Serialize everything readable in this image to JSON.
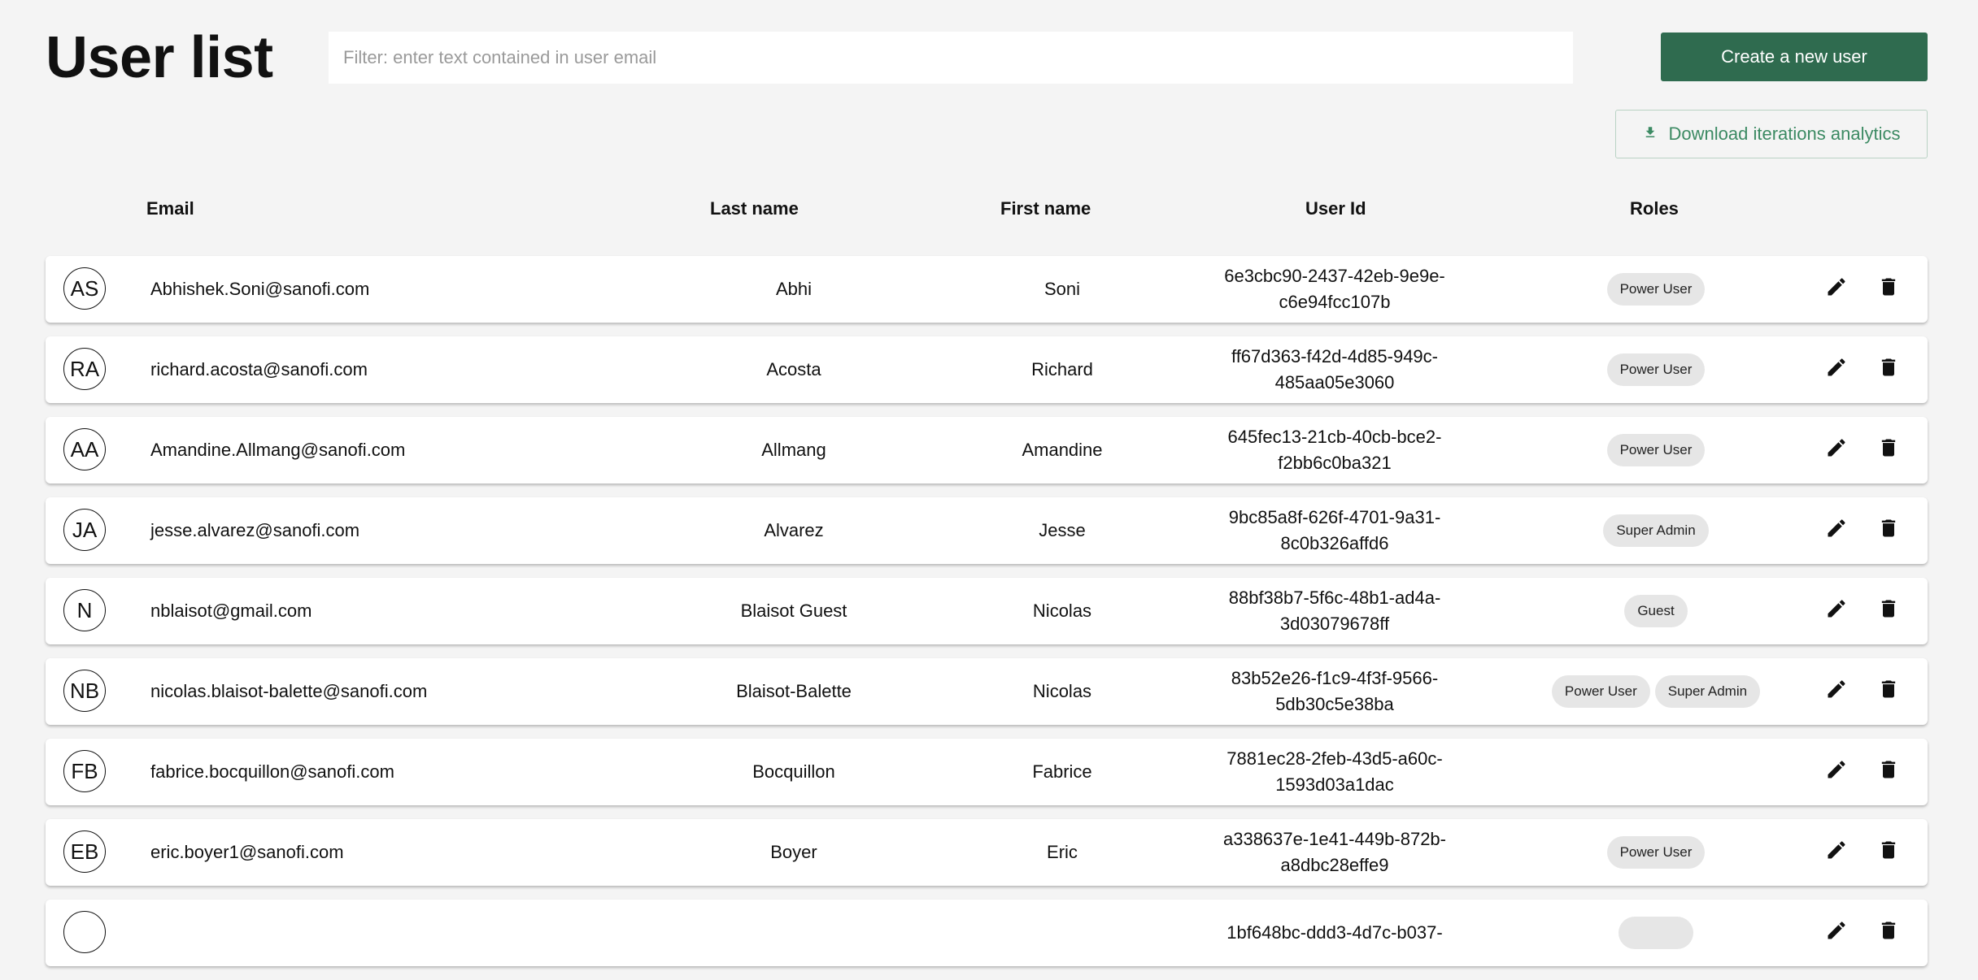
{
  "page": {
    "title": "User list"
  },
  "filter": {
    "placeholder": "Filter: enter text contained in user email",
    "value": ""
  },
  "actions": {
    "create_label": "Create a new user",
    "download_label": "Download iterations analytics",
    "download_icon": "download-icon"
  },
  "table": {
    "columns": {
      "email": "Email",
      "last_name": "Last name",
      "first_name": "First name",
      "user_id": "User Id",
      "roles": "Roles"
    },
    "row_action_icons": [
      "edit-icon",
      "delete-icon"
    ],
    "rows": [
      {
        "initials": "AS",
        "email": "Abhishek.Soni@sanofi.com",
        "last_name": "Abhi",
        "first_name": "Soni",
        "user_id_line1": "6e3cbc90-2437-42eb-9e9e-",
        "user_id_line2": "c6e94fcc107b",
        "roles": [
          "Power User"
        ]
      },
      {
        "initials": "RA",
        "email": "richard.acosta@sanofi.com",
        "last_name": "Acosta",
        "first_name": "Richard",
        "user_id_line1": "ff67d363-f42d-4d85-949c-",
        "user_id_line2": "485aa05e3060",
        "roles": [
          "Power User"
        ]
      },
      {
        "initials": "AA",
        "email": "Amandine.Allmang@sanofi.com",
        "last_name": "Allmang",
        "first_name": "Amandine",
        "user_id_line1": "645fec13-21cb-40cb-bce2-",
        "user_id_line2": "f2bb6c0ba321",
        "roles": [
          "Power User"
        ]
      },
      {
        "initials": "JA",
        "email": "jesse.alvarez@sanofi.com",
        "last_name": "Alvarez",
        "first_name": "Jesse",
        "user_id_line1": "9bc85a8f-626f-4701-9a31-",
        "user_id_line2": "8c0b326affd6",
        "roles": [
          "Super Admin"
        ]
      },
      {
        "initials": "N",
        "email": "nblaisot@gmail.com",
        "last_name": "Blaisot Guest",
        "first_name": "Nicolas",
        "user_id_line1": "88bf38b7-5f6c-48b1-ad4a-",
        "user_id_line2": "3d03079678ff",
        "roles": [
          "Guest"
        ]
      },
      {
        "initials": "NB",
        "email": "nicolas.blaisot-balette@sanofi.com",
        "last_name": "Blaisot-Balette",
        "first_name": "Nicolas",
        "user_id_line1": "83b52e26-f1c9-4f3f-9566-",
        "user_id_line2": "5db30c5e38ba",
        "roles": [
          "Power User",
          "Super Admin"
        ]
      },
      {
        "initials": "FB",
        "email": "fabrice.bocquillon@sanofi.com",
        "last_name": "Bocquillon",
        "first_name": "Fabrice",
        "user_id_line1": "7881ec28-2feb-43d5-a60c-",
        "user_id_line2": "1593d03a1dac",
        "roles": []
      },
      {
        "initials": "EB",
        "email": "eric.boyer1@sanofi.com",
        "last_name": "Boyer",
        "first_name": "Eric",
        "user_id_line1": "a338637e-1e41-449b-872b-",
        "user_id_line2": "a8dbc28effe9",
        "roles": [
          "Power User"
        ]
      },
      {
        "initials": "",
        "email": "",
        "last_name": "",
        "first_name": "",
        "user_id_line1": "1bf648bc-ddd3-4d7c-b037-",
        "user_id_line2": "",
        "roles": [
          ""
        ]
      }
    ]
  },
  "colors": {
    "primary": "#2f6b4f",
    "accent_text": "#3c8a63",
    "background": "#f4f4f4"
  }
}
